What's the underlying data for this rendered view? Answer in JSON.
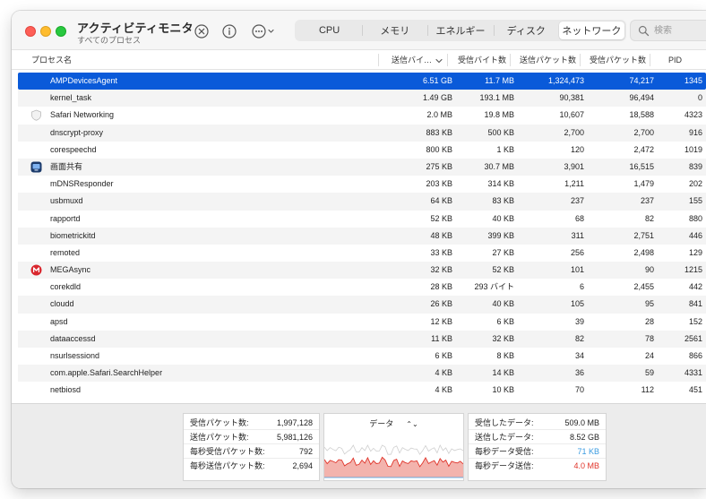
{
  "app": {
    "title": "アクティビティモニタ",
    "subtitle": "すべてのプロセス"
  },
  "toolbar": {
    "tabs": [
      {
        "label": "CPU",
        "active": false
      },
      {
        "label": "メモリ",
        "active": false
      },
      {
        "label": "エネルギー",
        "active": false
      },
      {
        "label": "ディスク",
        "active": false
      },
      {
        "label": "ネットワーク",
        "active": true
      }
    ],
    "search_placeholder": "検索"
  },
  "table": {
    "columns": {
      "name": "プロセス名",
      "sent_bytes": "送信バイ…",
      "recv_bytes": "受信バイト数",
      "sent_packets": "送信パケット数",
      "recv_packets": "受信パケット数",
      "pid": "PID"
    },
    "rows": [
      {
        "icon": "none",
        "name": "AMPDevicesAgent",
        "sent": "6.51 GB",
        "recv": "11.7 MB",
        "spk": "1,324,473",
        "rpk": "74,217",
        "pid": "1345",
        "selected": true
      },
      {
        "icon": "none",
        "name": "kernel_task",
        "sent": "1.49 GB",
        "recv": "193.1 MB",
        "spk": "90,381",
        "rpk": "96,494",
        "pid": "0"
      },
      {
        "icon": "shield",
        "name": "Safari Networking",
        "sent": "2.0 MB",
        "recv": "19.8 MB",
        "spk": "10,607",
        "rpk": "18,588",
        "pid": "4323"
      },
      {
        "icon": "none",
        "name": "dnscrypt-proxy",
        "sent": "883 KB",
        "recv": "500 KB",
        "spk": "2,700",
        "rpk": "2,700",
        "pid": "916"
      },
      {
        "icon": "none",
        "name": "corespeechd",
        "sent": "800 KB",
        "recv": "1 KB",
        "spk": "120",
        "rpk": "2,472",
        "pid": "1019"
      },
      {
        "icon": "screen-share",
        "name": "画面共有",
        "sent": "275 KB",
        "recv": "30.7 MB",
        "spk": "3,901",
        "rpk": "16,515",
        "pid": "839"
      },
      {
        "icon": "none",
        "name": "mDNSResponder",
        "sent": "203 KB",
        "recv": "314 KB",
        "spk": "1,211",
        "rpk": "1,479",
        "pid": "202"
      },
      {
        "icon": "none",
        "name": "usbmuxd",
        "sent": "64 KB",
        "recv": "83 KB",
        "spk": "237",
        "rpk": "237",
        "pid": "155"
      },
      {
        "icon": "none",
        "name": "rapportd",
        "sent": "52 KB",
        "recv": "40 KB",
        "spk": "68",
        "rpk": "82",
        "pid": "880"
      },
      {
        "icon": "none",
        "name": "biometrickitd",
        "sent": "48 KB",
        "recv": "399 KB",
        "spk": "311",
        "rpk": "2,751",
        "pid": "446"
      },
      {
        "icon": "none",
        "name": "remoted",
        "sent": "33 KB",
        "recv": "27 KB",
        "spk": "256",
        "rpk": "2,498",
        "pid": "129"
      },
      {
        "icon": "mega",
        "name": "MEGAsync",
        "sent": "32 KB",
        "recv": "52 KB",
        "spk": "101",
        "rpk": "90",
        "pid": "1215"
      },
      {
        "icon": "none",
        "name": "corekdld",
        "sent": "28 KB",
        "recv": "293 バイト",
        "spk": "6",
        "rpk": "2,455",
        "pid": "442"
      },
      {
        "icon": "none",
        "name": "cloudd",
        "sent": "26 KB",
        "recv": "40 KB",
        "spk": "105",
        "rpk": "95",
        "pid": "841"
      },
      {
        "icon": "none",
        "name": "apsd",
        "sent": "12 KB",
        "recv": "6 KB",
        "spk": "39",
        "rpk": "28",
        "pid": "152"
      },
      {
        "icon": "none",
        "name": "dataaccessd",
        "sent": "11 KB",
        "recv": "32 KB",
        "spk": "82",
        "rpk": "78",
        "pid": "2561"
      },
      {
        "icon": "none",
        "name": "nsurlsessiond",
        "sent": "6 KB",
        "recv": "8 KB",
        "spk": "34",
        "rpk": "24",
        "pid": "866"
      },
      {
        "icon": "none",
        "name": "com.apple.Safari.SearchHelper",
        "sent": "4 KB",
        "recv": "14 KB",
        "spk": "36",
        "rpk": "59",
        "pid": "4331"
      },
      {
        "icon": "none",
        "name": "netbiosd",
        "sent": "4 KB",
        "recv": "10 KB",
        "spk": "70",
        "rpk": "112",
        "pid": "451"
      }
    ]
  },
  "stats": {
    "left": [
      {
        "label": "受信パケット数:",
        "value": "1,997,128"
      },
      {
        "label": "送信パケット数:",
        "value": "5,981,126"
      },
      {
        "label": "毎秒受信パケット数:",
        "value": "792"
      },
      {
        "label": "毎秒送信パケット数:",
        "value": "2,694"
      }
    ],
    "graph_title": "データ",
    "right": [
      {
        "label": "受信したデータ:",
        "value": "509.0 MB",
        "color": "#222222"
      },
      {
        "label": "送信したデータ:",
        "value": "8.52 GB",
        "color": "#222222"
      },
      {
        "label": "毎秒データ受信:",
        "value": "71 KB",
        "color": "#3a9be0"
      },
      {
        "label": "毎秒データ送信:",
        "value": "4.0 MB",
        "color": "#e0342a"
      }
    ]
  },
  "colors": {
    "selection": "#0a5ad9",
    "graph_sent": "#e0342a",
    "graph_sent_fill": "#f3b3ad",
    "graph_recv": "#3a9be0"
  }
}
